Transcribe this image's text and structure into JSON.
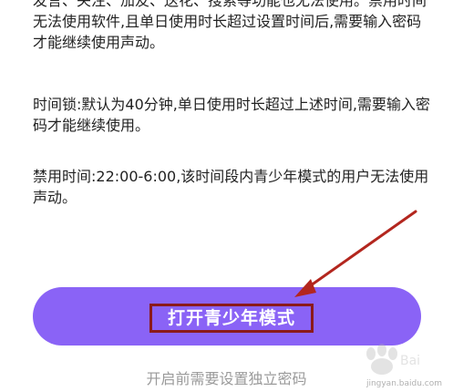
{
  "content": {
    "paragraph_1": "发言、关注、加友、送花、搜索等功能也无法使用。禁用时间无法使用软件,且单日使用时长超过设置时间后,需要输入密码才能继续使用声动。",
    "paragraph_2": "时间锁:默认为40分钟,单日使用时长超过上述时间,需要输入密码才能继续使用。",
    "paragraph_3": "禁用时间:22:00-6:00,该时间段内青少年模式的用户无法使用声动。"
  },
  "actions": {
    "open_button_label": "打开青少年模式",
    "hint": "开启前需要设置独立密码"
  },
  "watermark": {
    "text": "jingyan.baidu.com"
  },
  "colors": {
    "button": "#8a63f6",
    "highlight_box": "#8b1a1a",
    "arrow": "#b3261e",
    "hint": "#9a9a9a"
  }
}
